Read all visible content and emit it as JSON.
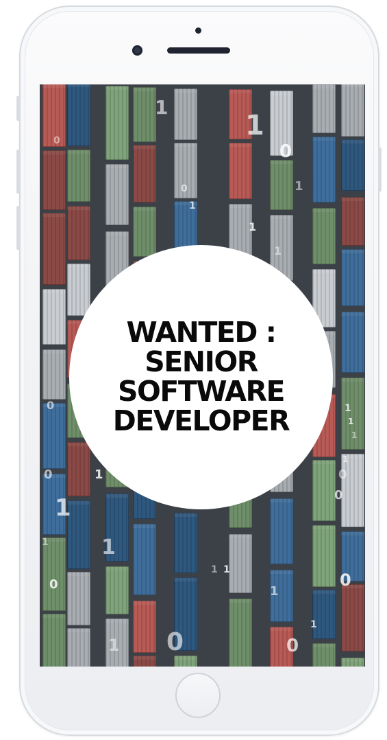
{
  "device": {
    "type": "smartphone",
    "body_color": "#f3f4f6",
    "icons": {
      "front_camera": "front-camera-icon",
      "speaker": "speaker-grille-icon",
      "home": "home-button"
    }
  },
  "screen": {
    "background": "aerial view of shipping containers",
    "headline": [
      "WANTED :",
      "SENIOR",
      "SOFTWARE",
      "DEVELOPER"
    ],
    "binary_digits": [
      "0",
      "1",
      "1",
      "0",
      "1",
      "0",
      "1",
      "1",
      "1",
      "0",
      "1",
      "1",
      "1",
      "0",
      "1",
      "1",
      "1",
      "1",
      "0",
      "0",
      "1",
      "1",
      "0",
      "0",
      "1",
      "0",
      "1",
      "1",
      "0",
      "1"
    ]
  },
  "colors": {
    "headline_text": "#0a0a0a",
    "circle": "#ffffff",
    "container_red": "#b85a55",
    "container_blue": "#3f6e9c",
    "container_green": "#7fa37a",
    "container_grey": "#a8adb2"
  }
}
